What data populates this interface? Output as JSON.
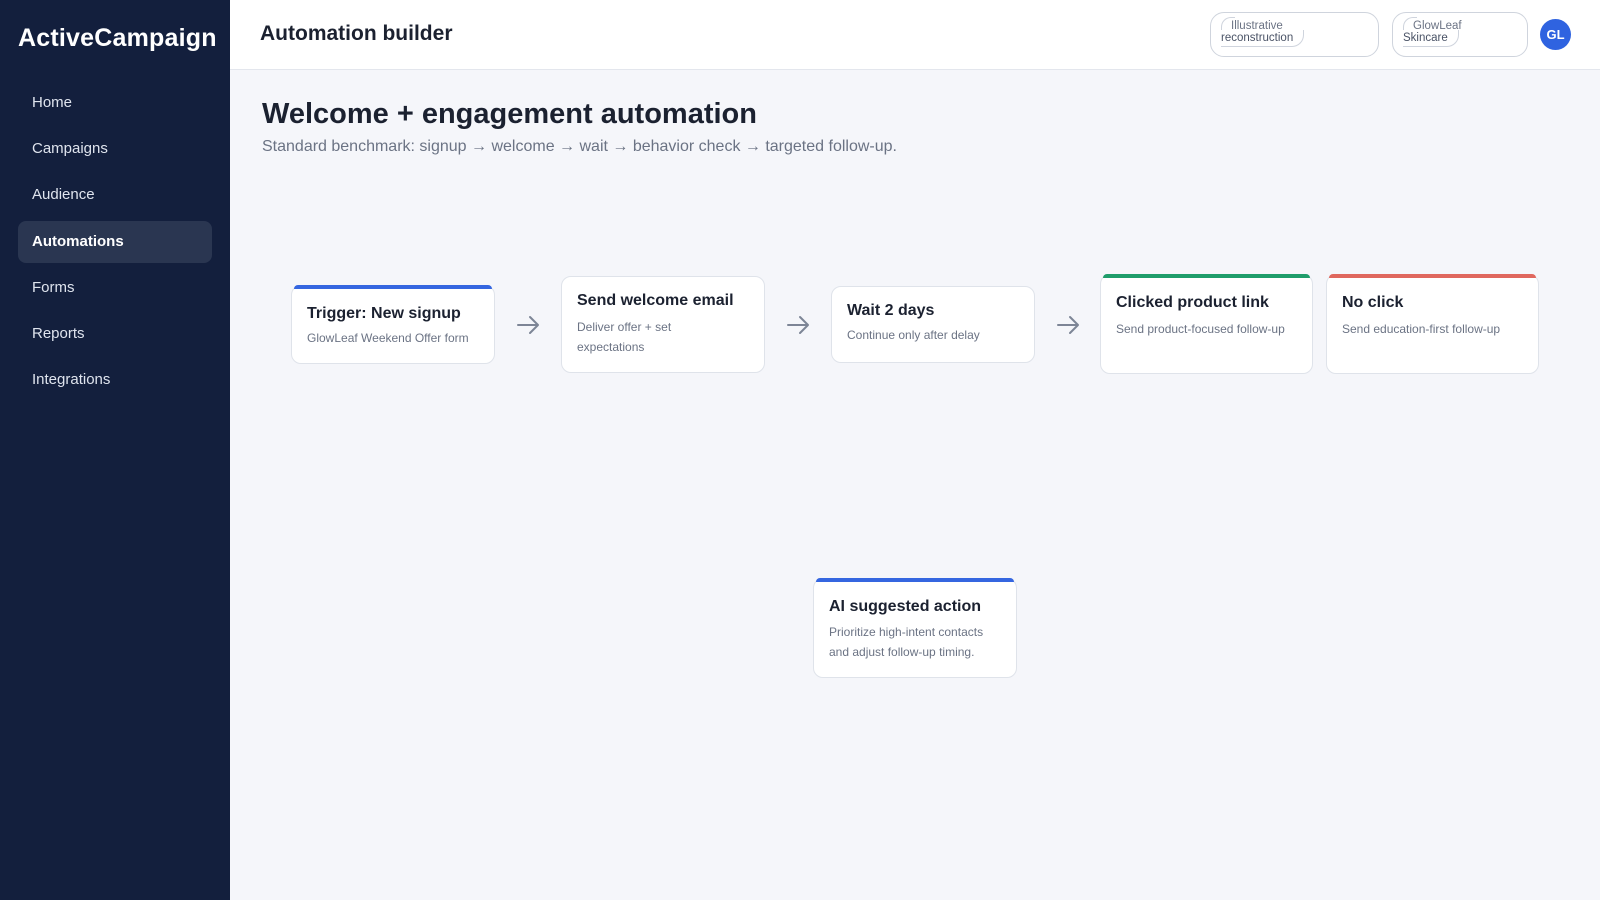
{
  "app": {
    "brand": "ActiveCampaign"
  },
  "sidebar": {
    "items": [
      {
        "label": "Home",
        "active": false
      },
      {
        "label": "Campaigns",
        "active": false
      },
      {
        "label": "Audience",
        "active": false
      },
      {
        "label": "Automations",
        "active": true
      },
      {
        "label": "Forms",
        "active": false
      },
      {
        "label": "Reports",
        "active": false
      },
      {
        "label": "Integrations",
        "active": false
      }
    ]
  },
  "header": {
    "title": "Automation builder",
    "pills": [
      {
        "line1": "Illustrative",
        "line2": "reconstruction"
      },
      {
        "line1": "GlowLeaf",
        "line2": "Skincare"
      }
    ],
    "avatar": "GL"
  },
  "page": {
    "title": "Welcome + engagement automation",
    "subtitle": "Standard benchmark: signup → welcome → wait → behavior check → targeted follow-up."
  },
  "flow": {
    "trigger": {
      "title": "Trigger: New signup",
      "desc": "GlowLeaf Weekend Offer form",
      "accent": "#3566e0"
    },
    "welcome": {
      "title": "Send welcome email",
      "desc": "Deliver offer + set expectations"
    },
    "wait": {
      "title": "Wait 2 days",
      "desc": "Continue only after delay"
    },
    "clicked": {
      "title": "Clicked product link",
      "desc": "Send product-focused follow-up",
      "accent": "#1f9d6b"
    },
    "noclick": {
      "title": "No click",
      "desc": "Send education-first follow-up",
      "accent": "#e0685e"
    },
    "ai": {
      "title": "AI suggested action",
      "desc": "Prioritize high-intent contacts and adjust follow-up timing.",
      "accent": "#3566e0"
    }
  },
  "colors": {
    "sidebar_bg": "#131f3d",
    "accent_blue": "#3566e0",
    "accent_green": "#1f9d6b",
    "accent_red": "#e0685e"
  },
  "icons": {
    "flow_arrow": "arrow-right-icon"
  }
}
